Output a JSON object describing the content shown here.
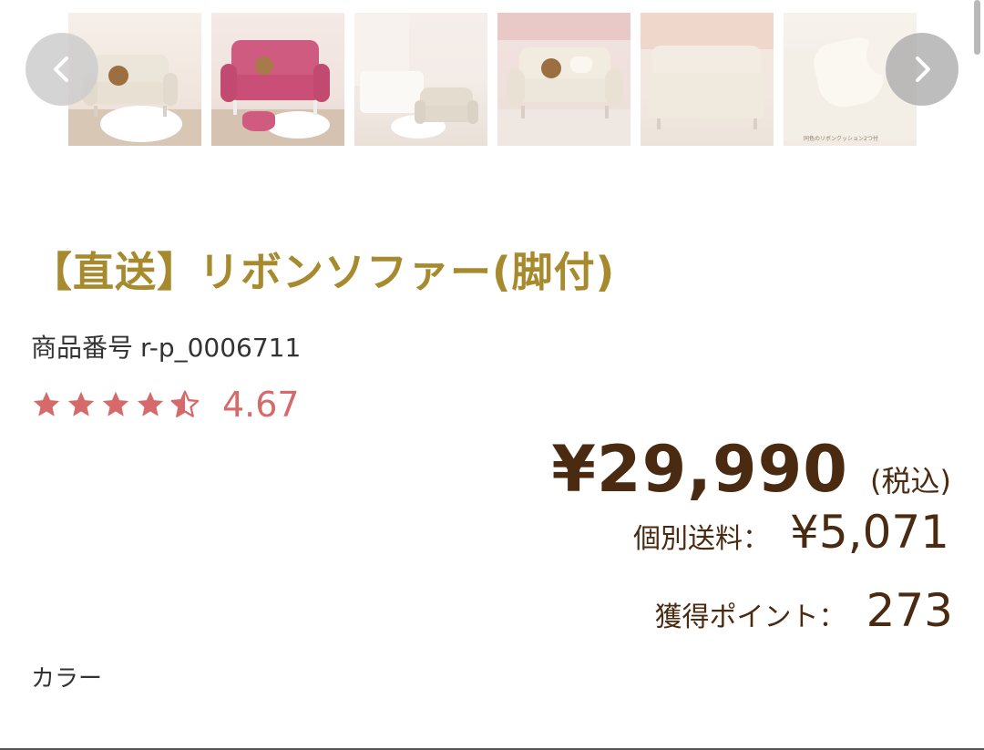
{
  "carousel": {
    "thumbnails": [
      {
        "alt": "white-sofa-room"
      },
      {
        "alt": "pink-sofa-room"
      },
      {
        "alt": "bedroom-sofa"
      },
      {
        "alt": "cream-sofa-teddy"
      },
      {
        "alt": "sofa-cushions"
      },
      {
        "alt": "ribbon-cushion-closeup",
        "caption": "同色のリボンクッション2つ付"
      }
    ],
    "prev_icon": "chevron-left-icon",
    "next_icon": "chevron-right-icon"
  },
  "product": {
    "title": "【直送】リボンソファー(脚付)",
    "code_label": "商品番号",
    "code": "r-p_0006711",
    "rating": 4.67,
    "rating_text": "4.67",
    "price": "¥29,990",
    "tax_note": "(税込)",
    "shipping_label": "個別送料：",
    "shipping_value": "¥5,071",
    "points_label": "獲得ポイント：",
    "points_value": "273",
    "color_label": "カラー"
  },
  "colors": {
    "title": "#a78a2e",
    "price": "#4a2a10",
    "star": "#d66a6a"
  }
}
